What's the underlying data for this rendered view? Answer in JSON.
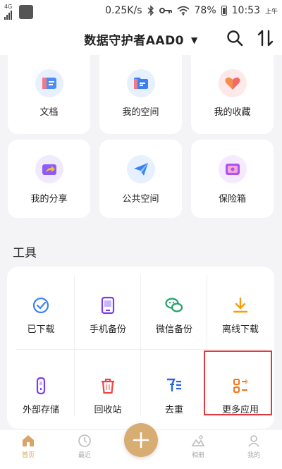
{
  "status_bar": {
    "network_type": "4G",
    "speed": "0.25K/s",
    "battery": "78%",
    "time": "10:53",
    "ampm": "上午"
  },
  "header": {
    "title": "数据守护者AAD0",
    "icons": [
      "search-icon",
      "sort-icon",
      "dropdown-caret-icon"
    ]
  },
  "tiles": [
    {
      "label": "文档",
      "icon": "document-icon",
      "color": "#4a8df8",
      "bg": "#e6f0fe"
    },
    {
      "label": "我的空间",
      "icon": "folder-icon",
      "color": "#3d7ff0",
      "bg": "#e6f0fe"
    },
    {
      "label": "我的收藏",
      "icon": "heart-icon",
      "color": "#f06a6a",
      "bg": "#fde8ea"
    },
    {
      "label": "我的分享",
      "icon": "share-icon",
      "color": "#8b5cf6",
      "bg": "#f1eafe"
    },
    {
      "label": "公共空间",
      "icon": "paper-plane-icon",
      "color": "#3b82f6",
      "bg": "#e6f0fe"
    },
    {
      "label": "保险箱",
      "icon": "safe-icon",
      "color": "#a855f7",
      "bg": "#f6eafe"
    }
  ],
  "tools": {
    "title": "工具",
    "items": [
      {
        "label": "已下载",
        "icon": "downloaded-icon",
        "color": "#3b82f6"
      },
      {
        "label": "手机备份",
        "icon": "phone-backup-icon",
        "color": "#7c3aed"
      },
      {
        "label": "微信备份",
        "icon": "wechat-icon",
        "color": "#22a06b"
      },
      {
        "label": "离线下载",
        "icon": "offline-download-icon",
        "color": "#f59e0b"
      },
      {
        "label": "外部存储",
        "icon": "usb-storage-icon",
        "color": "#7c3aed"
      },
      {
        "label": "回收站",
        "icon": "recycle-bin-icon",
        "color": "#ef4444"
      },
      {
        "label": "去重",
        "icon": "dedupe-icon",
        "color": "#2563eb"
      },
      {
        "label": "更多应用",
        "icon": "more-apps-icon",
        "color": "#f97316"
      }
    ],
    "highlight_color": "#e0393e"
  },
  "bottom_nav": {
    "items": [
      {
        "label": "首页",
        "icon": "home-icon",
        "active": true
      },
      {
        "label": "最近",
        "icon": "clock-icon",
        "active": false
      },
      {
        "label": "相册",
        "icon": "album-icon",
        "active": false
      },
      {
        "label": "我的",
        "icon": "profile-icon",
        "active": false
      }
    ],
    "fab_icon": "plus-icon",
    "accent": "#d8a467"
  }
}
